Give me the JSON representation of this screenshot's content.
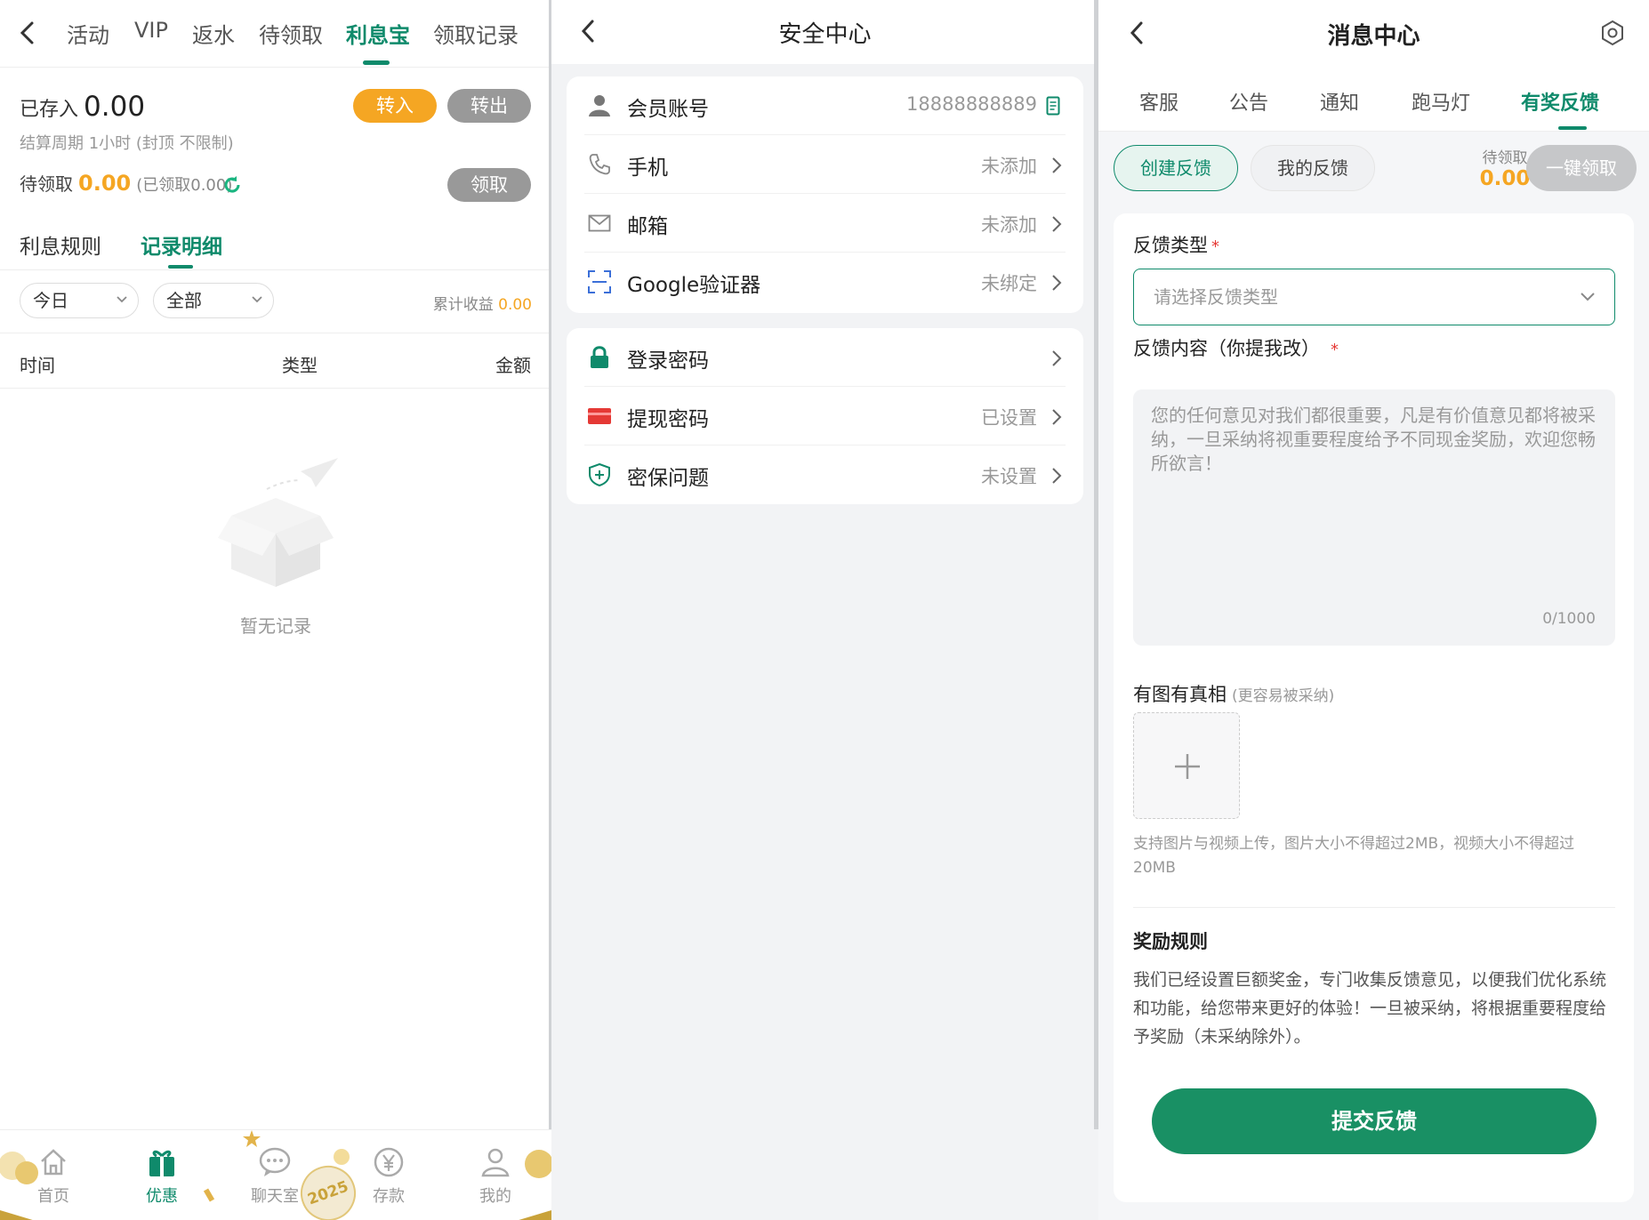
{
  "panel1": {
    "tabs": [
      "活动",
      "VIP",
      "返水",
      "待领取",
      "利息宝",
      "领取记录"
    ],
    "active_tab": "利息宝",
    "stored_label": "已存入",
    "stored_value": "0.00",
    "transfer_in": "转入",
    "transfer_out": "转出",
    "period": "结算周期 1小时 (封顶 不限制)",
    "pending_label": "待领取",
    "pending_value": "0.00",
    "claimed": "(已领取0.00)",
    "claim_button": "领取",
    "subtabs": [
      "利息规则",
      "记录明细"
    ],
    "filter_day": "今日",
    "filter_type": "全部",
    "total_label": "累计收益",
    "total_value": "0.00",
    "columns": [
      "时间",
      "类型",
      "金额"
    ],
    "empty": "暂无记录",
    "nav": [
      {
        "label": "首页",
        "icon": "home-icon"
      },
      {
        "label": "优惠",
        "icon": "gift-icon"
      },
      {
        "label": "聊天室",
        "icon": "chat-icon"
      },
      {
        "label": "存款",
        "icon": "yuan-icon"
      },
      {
        "label": "我的",
        "icon": "user-icon"
      }
    ],
    "badge": "2025"
  },
  "panel2": {
    "title": "安全中心",
    "group1": [
      {
        "label": "会员账号",
        "value": "18888888889",
        "icon": "user-icon"
      },
      {
        "label": "手机",
        "value": "未添加",
        "icon": "phone-icon"
      },
      {
        "label": "邮箱",
        "value": "未添加",
        "icon": "mail-icon"
      },
      {
        "label": "Google验证器",
        "value": "未绑定",
        "icon": "scan-icon"
      }
    ],
    "group2": [
      {
        "label": "登录密码",
        "value": "",
        "icon": "lock-icon"
      },
      {
        "label": "提现密码",
        "value": "已设置",
        "icon": "card-icon"
      },
      {
        "label": "密保问题",
        "value": "未设置",
        "icon": "shield-icon"
      }
    ]
  },
  "panel3": {
    "title": "消息中心",
    "tabs": [
      "客服",
      "公告",
      "通知",
      "跑马灯",
      "有奖反馈"
    ],
    "create": "创建反馈",
    "mine": "我的反馈",
    "pending_label": "待领取",
    "pending_value": "0.00",
    "one_key": "一键领取",
    "type_label": "反馈类型",
    "type_placeholder": "请选择反馈类型",
    "content_label": "反馈内容（你提我改）",
    "content_placeholder": "您的任何意见对我们都很重要，凡是有价值意见都将被采纳，一旦采纳将视重要程度给予不同现金奖励，欢迎您畅所欲言！",
    "counter": "0/1000",
    "image_label": "有图有真相",
    "image_hint": "(更容易被采纳)",
    "upload_note": "支持图片与视频上传，图片大小不得超过2MB，视频大小不得超过20MB",
    "rules_title": "奖励规则",
    "rules_text": "我们已经设置巨额奖金，专门收集反馈意见，以便我们优化系统和功能，给您带来更好的体验！一旦被采纳，将根据重要程度给予奖励（未采纳除外）。",
    "submit": "提交反馈",
    "required_mark": "*"
  },
  "colors": {
    "accent": "#0f8a6b",
    "orange": "#f5a623",
    "gray_button": "#999999",
    "submit": "#199064"
  }
}
